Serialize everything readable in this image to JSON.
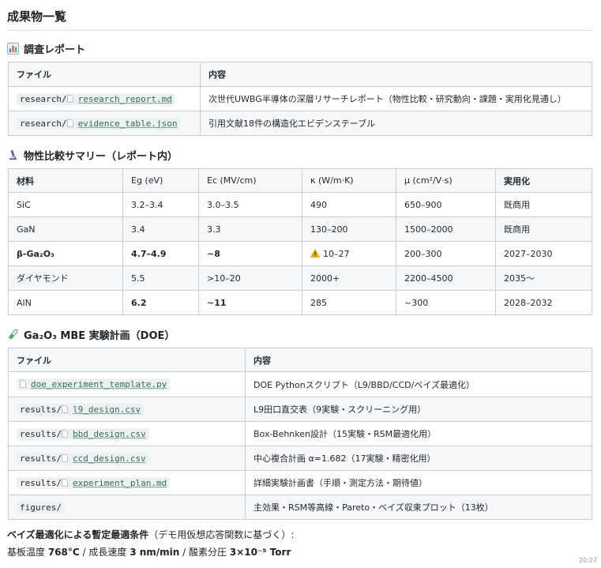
{
  "page": {
    "title": "成果物一覧",
    "timestamp": "20:27"
  },
  "section1": {
    "title": "調査レポート",
    "icon": "bar-chart-icon",
    "headers": [
      "ファイル",
      "内容"
    ],
    "rows": [
      {
        "prefix": "research/",
        "file": "research_report.md",
        "desc": "次世代UWBG半導体の深層リサーチレポート（物性比較・研究動向・課題・実用化見通し）"
      },
      {
        "prefix": "research/",
        "file": "evidence_table.json",
        "desc": "引用文献18件の構造化エビデンステーブル"
      }
    ]
  },
  "section2": {
    "title": "物性比較サマリー（レポート内）",
    "icon": "microscope-icon",
    "headers": [
      "材料",
      "Eg (eV)",
      "Ec (MV/cm)",
      "κ (W/m·K)",
      "μ (cm²/V·s)",
      "実用化"
    ],
    "rows": [
      [
        "SiC",
        "3.2–3.4",
        "3.0–3.5",
        "490",
        "650–900",
        "既商用"
      ],
      [
        "GaN",
        "3.4",
        "3.3",
        "130–200",
        "1500–2000",
        "既商用"
      ],
      [
        "β-Ga₂O₃",
        "4.7–4.9",
        "~8",
        "10–27",
        "200–300",
        "2027–2030"
      ],
      [
        "ダイヤモンド",
        "5.5",
        ">10–20",
        "2000+",
        "2200–4500",
        "2035〜"
      ],
      [
        "AlN",
        "6.2",
        "~11",
        "285",
        "~300",
        "2028–2032"
      ]
    ]
  },
  "section3": {
    "title": "Ga₂O₃ MBE 実験計画（DOE）",
    "icon": "test-tube-icon",
    "headers": [
      "ファイル",
      "内容"
    ],
    "rows": [
      {
        "prefix": "",
        "file": "doe_experiment_template.py",
        "desc": "DOE Pythonスクリプト（L9/BBD/CCD/ベイズ最適化）"
      },
      {
        "prefix": "results/",
        "file": "l9_design.csv",
        "desc": "L9田口直交表（9実験・スクリーニング用）"
      },
      {
        "prefix": "results/",
        "file": "bbd_design.csv",
        "desc": "Box-Behnken設計（15実験・RSM最適化用）"
      },
      {
        "prefix": "results/",
        "file": "ccd_design.csv",
        "desc": "中心複合計画 α=1.682（17実験・精密化用）"
      },
      {
        "prefix": "results/",
        "file": "experiment_plan.md",
        "desc": "詳細実験計画書（手順・測定方法・期待値）"
      },
      {
        "prefix": "figures/",
        "file": "",
        "desc": "主効果・RSM等高線・Pareto・ベイズ収束プロット（13枚）"
      }
    ]
  },
  "summary": {
    "heading": "ベイズ最適化による暫定最適条件",
    "note": "（デモ用仮想応答関数に基づく）:",
    "temp_label": "基板温度 ",
    "temp_value": "768°C",
    "sep1": " / 成長速度 ",
    "rate_value": "3 nm/min",
    "sep2": " / 酸素分圧 ",
    "pressure_value": "3×10⁻⁵ Torr"
  }
}
